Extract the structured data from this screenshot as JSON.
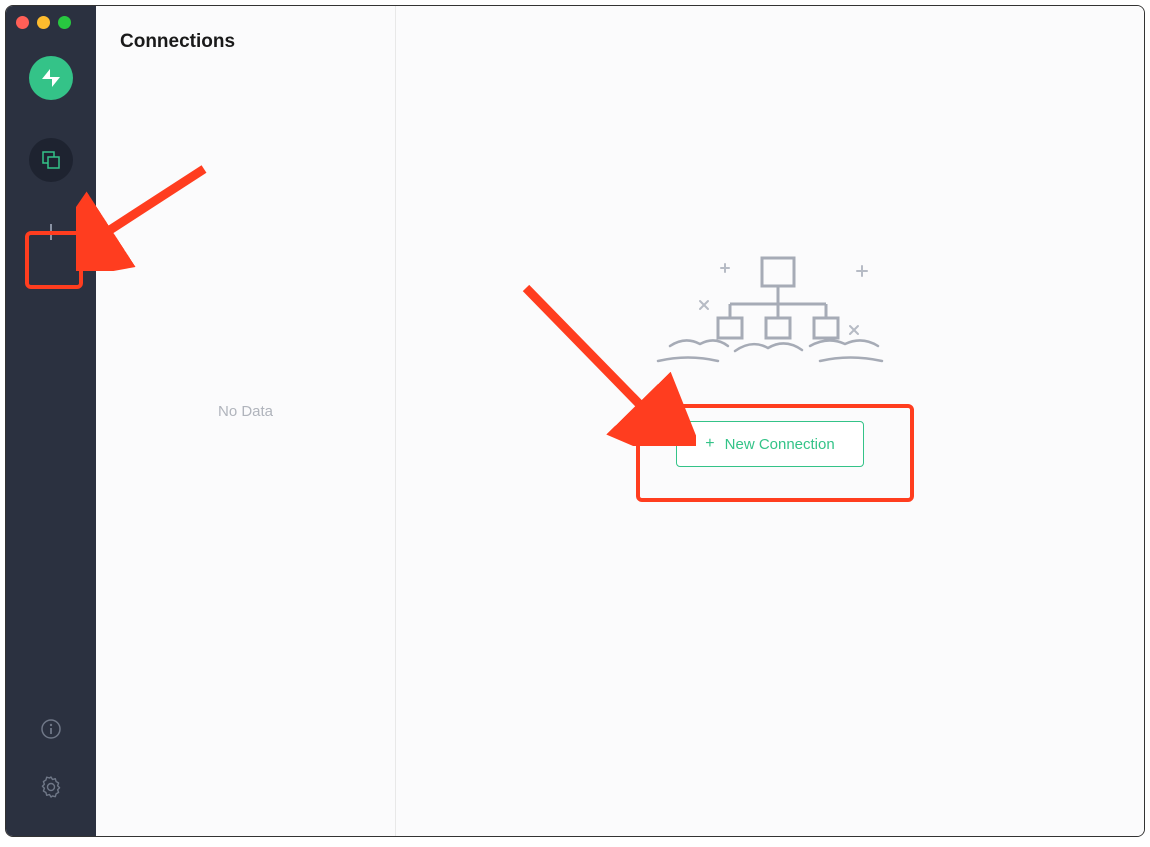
{
  "panel": {
    "title": "Connections",
    "empty_text": "No Data"
  },
  "main": {
    "new_connection_label": "New Connection"
  },
  "colors": {
    "accent": "#34c388",
    "highlight": "#ff3d1f",
    "sidebar_bg": "#2b3140"
  },
  "icons": {
    "logo": "app-logo",
    "connections": "connections-icon",
    "add": "plus-icon",
    "info": "info-icon",
    "settings": "gear-icon"
  }
}
